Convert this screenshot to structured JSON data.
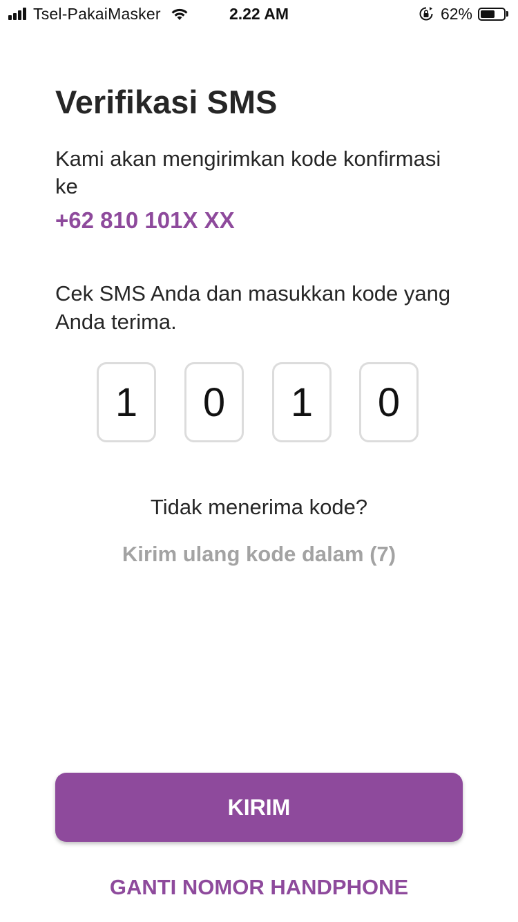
{
  "status_bar": {
    "carrier": "Tsel-PakaiMasker",
    "time": "2.22 AM",
    "battery_percent_label": "62%",
    "battery_level": 0.62,
    "icons": [
      "signal-icon",
      "wifi-icon",
      "rotation-lock-icon",
      "battery-icon"
    ]
  },
  "page": {
    "title": "Verifikasi SMS",
    "description": "Kami akan mengirimkan kode konfirmasi ke",
    "phone_number": "+62 810 101X XX",
    "instruction": "Cek SMS Anda dan masukkan kode yang Anda terima.",
    "code_digits": [
      "1",
      "0",
      "1",
      "0"
    ],
    "no_code_text": "Tidak menerima kode?",
    "resend_text": "Kirim ulang kode dalam (7)",
    "submit_label": "KIRIM",
    "change_number_label": "GANTI NOMOR HANDPHONE"
  },
  "colors": {
    "accent": "#8e4a9c",
    "text": "#262626",
    "muted": "#a3a3a3",
    "code_border": "#dcdcdc"
  }
}
